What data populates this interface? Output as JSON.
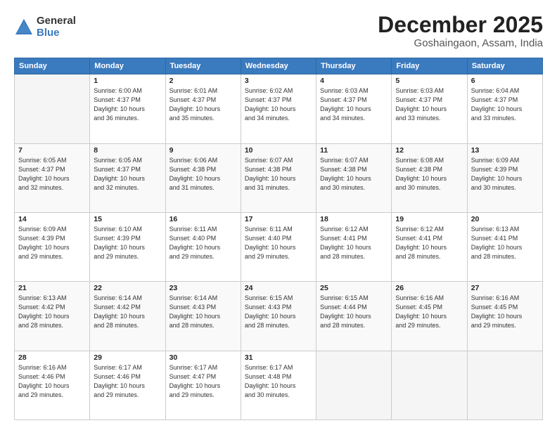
{
  "header": {
    "logo_general": "General",
    "logo_blue": "Blue",
    "month": "December 2025",
    "location": "Goshaingaon, Assam, India"
  },
  "days_of_week": [
    "Sunday",
    "Monday",
    "Tuesday",
    "Wednesday",
    "Thursday",
    "Friday",
    "Saturday"
  ],
  "weeks": [
    [
      {
        "num": "",
        "info": ""
      },
      {
        "num": "1",
        "info": "Sunrise: 6:00 AM\nSunset: 4:37 PM\nDaylight: 10 hours\nand 36 minutes."
      },
      {
        "num": "2",
        "info": "Sunrise: 6:01 AM\nSunset: 4:37 PM\nDaylight: 10 hours\nand 35 minutes."
      },
      {
        "num": "3",
        "info": "Sunrise: 6:02 AM\nSunset: 4:37 PM\nDaylight: 10 hours\nand 34 minutes."
      },
      {
        "num": "4",
        "info": "Sunrise: 6:03 AM\nSunset: 4:37 PM\nDaylight: 10 hours\nand 34 minutes."
      },
      {
        "num": "5",
        "info": "Sunrise: 6:03 AM\nSunset: 4:37 PM\nDaylight: 10 hours\nand 33 minutes."
      },
      {
        "num": "6",
        "info": "Sunrise: 6:04 AM\nSunset: 4:37 PM\nDaylight: 10 hours\nand 33 minutes."
      }
    ],
    [
      {
        "num": "7",
        "info": "Sunrise: 6:05 AM\nSunset: 4:37 PM\nDaylight: 10 hours\nand 32 minutes."
      },
      {
        "num": "8",
        "info": "Sunrise: 6:05 AM\nSunset: 4:37 PM\nDaylight: 10 hours\nand 32 minutes."
      },
      {
        "num": "9",
        "info": "Sunrise: 6:06 AM\nSunset: 4:38 PM\nDaylight: 10 hours\nand 31 minutes."
      },
      {
        "num": "10",
        "info": "Sunrise: 6:07 AM\nSunset: 4:38 PM\nDaylight: 10 hours\nand 31 minutes."
      },
      {
        "num": "11",
        "info": "Sunrise: 6:07 AM\nSunset: 4:38 PM\nDaylight: 10 hours\nand 30 minutes."
      },
      {
        "num": "12",
        "info": "Sunrise: 6:08 AM\nSunset: 4:38 PM\nDaylight: 10 hours\nand 30 minutes."
      },
      {
        "num": "13",
        "info": "Sunrise: 6:09 AM\nSunset: 4:39 PM\nDaylight: 10 hours\nand 30 minutes."
      }
    ],
    [
      {
        "num": "14",
        "info": "Sunrise: 6:09 AM\nSunset: 4:39 PM\nDaylight: 10 hours\nand 29 minutes."
      },
      {
        "num": "15",
        "info": "Sunrise: 6:10 AM\nSunset: 4:39 PM\nDaylight: 10 hours\nand 29 minutes."
      },
      {
        "num": "16",
        "info": "Sunrise: 6:11 AM\nSunset: 4:40 PM\nDaylight: 10 hours\nand 29 minutes."
      },
      {
        "num": "17",
        "info": "Sunrise: 6:11 AM\nSunset: 4:40 PM\nDaylight: 10 hours\nand 29 minutes."
      },
      {
        "num": "18",
        "info": "Sunrise: 6:12 AM\nSunset: 4:41 PM\nDaylight: 10 hours\nand 28 minutes."
      },
      {
        "num": "19",
        "info": "Sunrise: 6:12 AM\nSunset: 4:41 PM\nDaylight: 10 hours\nand 28 minutes."
      },
      {
        "num": "20",
        "info": "Sunrise: 6:13 AM\nSunset: 4:41 PM\nDaylight: 10 hours\nand 28 minutes."
      }
    ],
    [
      {
        "num": "21",
        "info": "Sunrise: 6:13 AM\nSunset: 4:42 PM\nDaylight: 10 hours\nand 28 minutes."
      },
      {
        "num": "22",
        "info": "Sunrise: 6:14 AM\nSunset: 4:42 PM\nDaylight: 10 hours\nand 28 minutes."
      },
      {
        "num": "23",
        "info": "Sunrise: 6:14 AM\nSunset: 4:43 PM\nDaylight: 10 hours\nand 28 minutes."
      },
      {
        "num": "24",
        "info": "Sunrise: 6:15 AM\nSunset: 4:43 PM\nDaylight: 10 hours\nand 28 minutes."
      },
      {
        "num": "25",
        "info": "Sunrise: 6:15 AM\nSunset: 4:44 PM\nDaylight: 10 hours\nand 28 minutes."
      },
      {
        "num": "26",
        "info": "Sunrise: 6:16 AM\nSunset: 4:45 PM\nDaylight: 10 hours\nand 29 minutes."
      },
      {
        "num": "27",
        "info": "Sunrise: 6:16 AM\nSunset: 4:45 PM\nDaylight: 10 hours\nand 29 minutes."
      }
    ],
    [
      {
        "num": "28",
        "info": "Sunrise: 6:16 AM\nSunset: 4:46 PM\nDaylight: 10 hours\nand 29 minutes."
      },
      {
        "num": "29",
        "info": "Sunrise: 6:17 AM\nSunset: 4:46 PM\nDaylight: 10 hours\nand 29 minutes."
      },
      {
        "num": "30",
        "info": "Sunrise: 6:17 AM\nSunset: 4:47 PM\nDaylight: 10 hours\nand 29 minutes."
      },
      {
        "num": "31",
        "info": "Sunrise: 6:17 AM\nSunset: 4:48 PM\nDaylight: 10 hours\nand 30 minutes."
      },
      {
        "num": "",
        "info": ""
      },
      {
        "num": "",
        "info": ""
      },
      {
        "num": "",
        "info": ""
      }
    ]
  ]
}
